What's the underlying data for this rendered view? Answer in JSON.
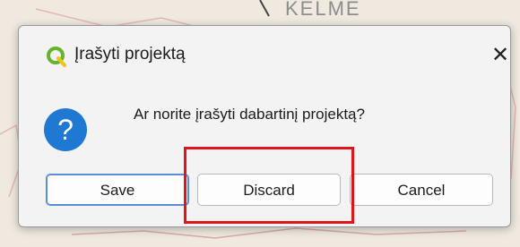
{
  "map": {
    "place_label": "KELMĖ"
  },
  "dialog": {
    "title": "Įrašyti projektą",
    "close_label": "✕",
    "icon_glyph": "?",
    "message": "Ar norite įrašyti dabartinį projektą?",
    "buttons": {
      "save": "Save",
      "discard": "Discard",
      "cancel": "Cancel"
    }
  },
  "icons": {
    "app": "qgis-logo-icon",
    "close": "close-icon",
    "question": "question-icon"
  },
  "colors": {
    "highlight": "#e2141b",
    "question_icon": "#1f78d1",
    "qgis_green": "#66b32e"
  }
}
